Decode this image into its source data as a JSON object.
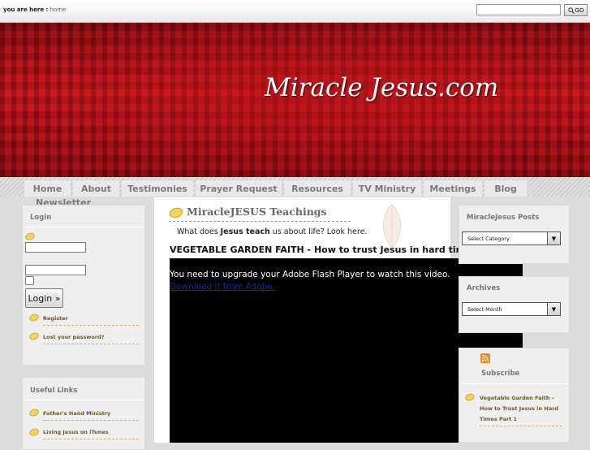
{
  "topbar": {
    "breadcrumb_prefix": "you are here :",
    "breadcrumb_home": "home",
    "search_placeholder": "",
    "search_button": "GO"
  },
  "header": {
    "site_title": "Miracle Jesus.com"
  },
  "nav": {
    "items": [
      {
        "label": "Home"
      },
      {
        "label": "About"
      },
      {
        "label": "Testimonies"
      },
      {
        "label": "Prayer Request"
      },
      {
        "label": "Resources"
      },
      {
        "label": "TV Ministry"
      },
      {
        "label": "Meetings"
      },
      {
        "label": "Blog"
      },
      {
        "label": "Newsletter"
      }
    ]
  },
  "main": {
    "title": "MiracleJESUS Teachings",
    "intro_before": "What does ",
    "intro_bold": "Jesus teach",
    "intro_after": " us about life? Look here.",
    "video_title": "VEGETABLE GARDEN FAITH - How to trust Jesus in hard times - I",
    "video_message": "You need to upgrade your Adobe Flash Player to watch this video.",
    "video_link": "Download it from Adobe."
  },
  "left_sidebar": {
    "login": {
      "heading": "Login",
      "username_value": "",
      "password_value": "",
      "remember_checked": false,
      "button": "Login »",
      "links": [
        {
          "label": "Register"
        },
        {
          "label": "Lost your password?"
        }
      ]
    },
    "useful_links": {
      "heading": "Useful Links",
      "links": [
        {
          "label": "Father's Hand Ministry"
        },
        {
          "label": "Living Jesus on iTunes"
        }
      ]
    }
  },
  "right_sidebar": {
    "posts": {
      "heading": "MiracleJesus Posts",
      "select_value": "Select Category"
    },
    "archives": {
      "heading": "Archives",
      "select_value": "Select Month"
    },
    "subscribe": {
      "heading": "Subscribe",
      "icon": "rss-icon",
      "items": [
        {
          "label": "Vegetable Garden Faith – How to Trust Jesus in Hard Times Part 1"
        }
      ]
    }
  },
  "colors": {
    "header_red": "#b01218",
    "link_brown": "#6d5a2a",
    "nav_text": "#7a7a7a"
  }
}
